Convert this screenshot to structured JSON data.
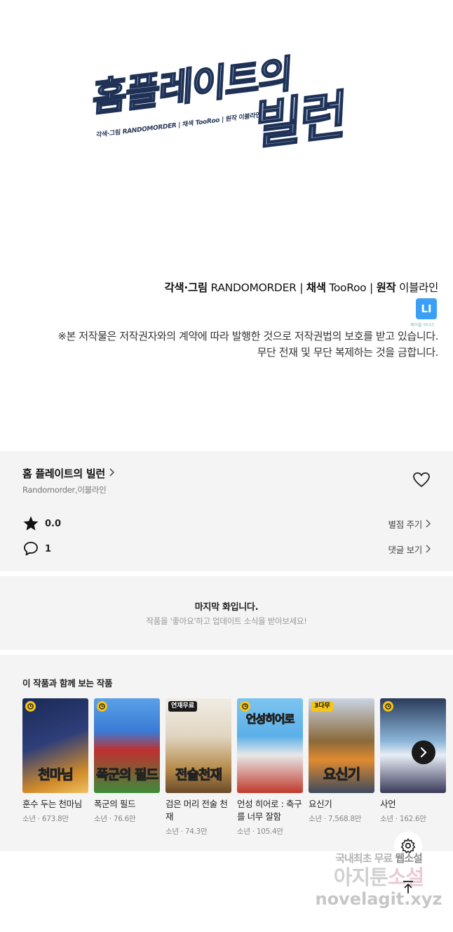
{
  "hero": {
    "logo_title": "홈플레이트의",
    "logo_sub": "빌런",
    "logo_credit": "각색·그림 RANDOMORDER | 채색 TooRoo | 원작 이블라인",
    "credit_label_1": "각색·그림",
    "credit_value_1": "RANDOMORDER",
    "credit_label_2": "채색",
    "credit_value_2": "TooRoo",
    "credit_label_3": "원작",
    "credit_value_3": "이블라인",
    "sep": "|",
    "badge_text": "LI",
    "badge_caption": "레이블 이너스",
    "notice_line_1": "※본 저작물은 저작권자와의 계약에 따라 발행한 것으로 저작권법의 보호를 받고 있습니다.",
    "notice_line_2": "무단 전재 및 무단 복제하는 것을 금합니다."
  },
  "info": {
    "title": "홈 플레이트의 빌런",
    "author": "Randomorder,이블라인",
    "rating": "0.0",
    "rate_action": "별점 주기",
    "comment_count": "1",
    "comment_action": "댓글 보기"
  },
  "last_episode": {
    "title": "마지막 화입니다.",
    "subtitle": "작품을 '좋아요'하고 업데이트 소식을 받아보세요!"
  },
  "recommendations": {
    "heading": "이 작품과 함께 보는 작품",
    "items": [
      {
        "title": "훈수 두는 천마님",
        "meta": "소년 · 673.8만",
        "badge": "",
        "art": "천마님",
        "c1": "#1b2a55",
        "c2": "#d08a2a"
      },
      {
        "title": "폭군의 필드",
        "meta": "소년 · 76.6만",
        "badge": "",
        "art": "폭군의 필드",
        "c1": "#3a7bd5",
        "c2": "#3d8b3a"
      },
      {
        "title": "검은 머리 전술 천재",
        "meta": "소년 · 74.3만",
        "badge": "연재무료",
        "art": "전술천재",
        "c1": "#e8e2d6",
        "c2": "#b58a4a"
      },
      {
        "title": "언성 히어로 : 축구를 너무 잘함",
        "meta": "소년 · 105.4만",
        "badge": "",
        "art": "언성히어로",
        "c1": "#5bb0e8",
        "c2": "#c0392b"
      },
      {
        "title": "요신기",
        "meta": "소년 · 7,568.8만",
        "badge": "3다무",
        "art": "요신기",
        "c1": "#8a6a3a",
        "c2": "#3d4a5e"
      },
      {
        "title": "사언",
        "meta": "소년 · 162.6만",
        "badge": "",
        "art": "",
        "c1": "#2b3b5a",
        "c2": "#8ab4d8"
      }
    ]
  },
  "watermark": {
    "line1_a": "국내최초 무료 ",
    "line1_b": "웹소설",
    "line2_a": "아지툰",
    "line2_b": "소설",
    "line3": "novelagit.xyz"
  }
}
